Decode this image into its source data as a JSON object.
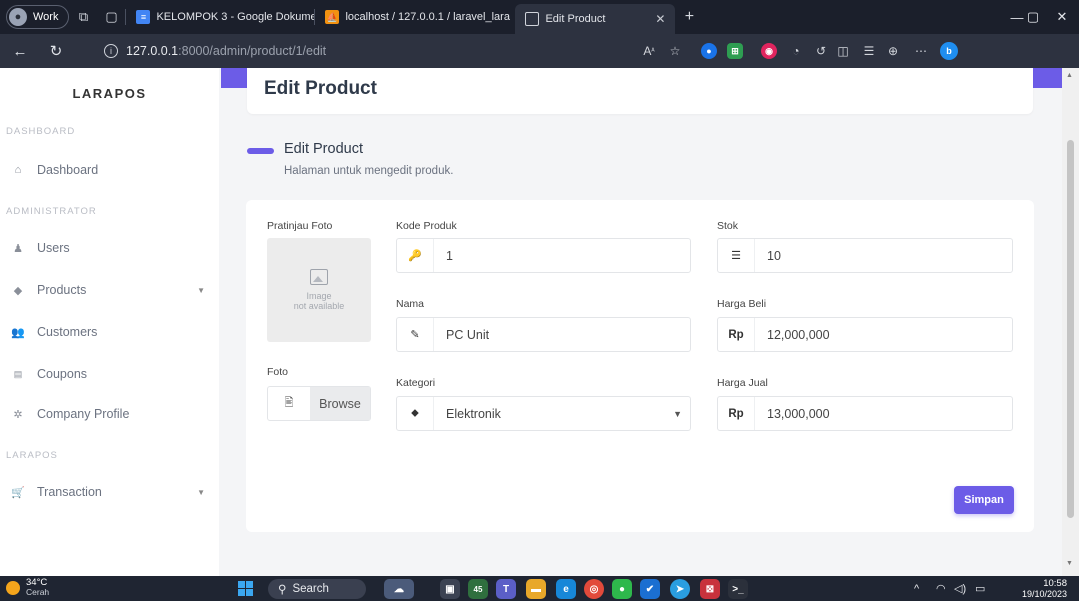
{
  "browser": {
    "profile_label": "Work",
    "tabs": [
      {
        "label": "KELOMPOK 3 - Google Dokumen",
        "active": false
      },
      {
        "label": "localhost / 127.0.0.1 / laravel_lara",
        "active": false
      },
      {
        "label": "Edit Product",
        "active": true
      }
    ],
    "url_host": "127.0.0.1",
    "url_rest": ":8000/admin/product/1/edit"
  },
  "sidebar": {
    "brand": "LARAPOS",
    "headings": {
      "dashboard": "DASHBOARD",
      "admin": "ADMINISTRATOR",
      "larapos": "LARAPOS"
    },
    "items": {
      "dashboard": "Dashboard",
      "users": "Users",
      "products": "Products",
      "customers": "Customers",
      "coupons": "Coupons",
      "company": "Company Profile",
      "transaction": "Transaction"
    }
  },
  "header": {
    "title": "Edit Product"
  },
  "section": {
    "title": "Edit Product",
    "subtitle": "Halaman untuk mengedit produk."
  },
  "form": {
    "preview_label": "Pratinjau Foto",
    "preview_text_1": "Image",
    "preview_text_2": "not available",
    "foto_label": "Foto",
    "browse_label": "Browse",
    "kode_label": "Kode Produk",
    "kode_value": "1",
    "nama_label": "Nama",
    "nama_value": "PC Unit",
    "kategori_label": "Kategori",
    "kategori_value": "Elektronik",
    "stok_label": "Stok",
    "stok_value": "10",
    "harga_beli_label": "Harga Beli",
    "harga_beli_prefix": "Rp",
    "harga_beli_value": "12,000,000",
    "harga_jual_label": "Harga Jual",
    "harga_jual_prefix": "Rp",
    "harga_jual_value": "13,000,000",
    "save_label": "Simpan"
  },
  "taskbar": {
    "temperature": "34°C",
    "weather": "Cerah",
    "search_label": "Search",
    "time": "10:58",
    "date": "19/10/2023",
    "badge_count": "45"
  },
  "colors": {
    "accent": "#6c5ce7",
    "taskbar": "#1f2532",
    "titlebar": "#1b1f2b"
  }
}
